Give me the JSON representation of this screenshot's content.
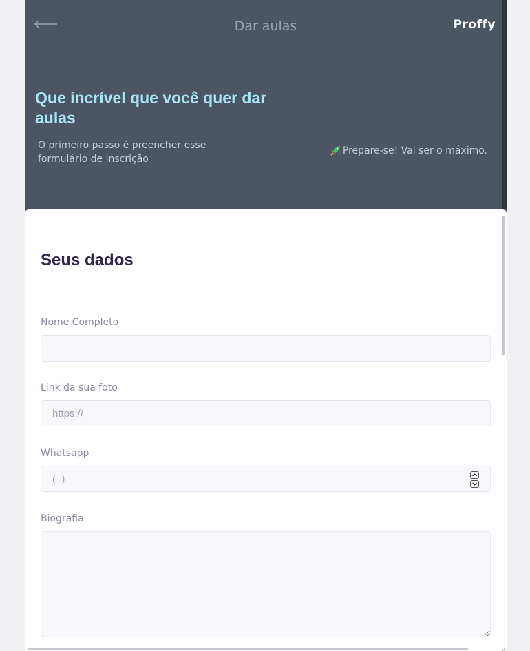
{
  "top_bar": {
    "back_icon": "arrow-left-icon",
    "title": "Dar aulas",
    "logo": "Proffy"
  },
  "hero": {
    "title": "Que incrível que você quer dar aulas",
    "description": "O primeiro passo é preencher esse formulário de inscrição",
    "note_icon": "rocket-icon",
    "note": "Prepare-se! Vai ser o máximo."
  },
  "form": {
    "section_title": "Seus dados",
    "fields": {
      "name": {
        "label": "Nome Completo",
        "value": "",
        "placeholder": ""
      },
      "avatar": {
        "label": "Link da sua foto",
        "value": "",
        "placeholder": "https://"
      },
      "whatsapp": {
        "label": "Whatsapp",
        "value": "",
        "placeholder": "(  ) _ _ _ _  _ _ _ _"
      },
      "bio": {
        "label": "Biografia",
        "value": ""
      }
    }
  },
  "colors": {
    "header_bg": "#4b5563",
    "hero_title": "#a9e4f5",
    "card_bg": "#ffffff",
    "section_title": "#32264d",
    "input_bg": "#f8f8fc"
  }
}
